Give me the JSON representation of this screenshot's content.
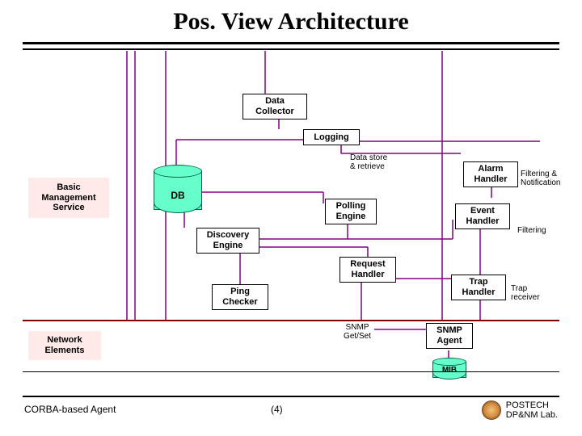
{
  "title": "Pos. View Architecture",
  "left_labels": {
    "basic_mgmt": [
      "Basic",
      "Management",
      "Service"
    ],
    "network_elements": [
      "Network",
      "Elements"
    ]
  },
  "boxes": {
    "data_collector": [
      "Data",
      "Collector"
    ],
    "logging": "Logging",
    "db": "DB",
    "discovery_engine": [
      "Discovery",
      "Engine"
    ],
    "polling_engine": [
      "Polling",
      "Engine"
    ],
    "ping_checker": [
      "Ping",
      "Checker"
    ],
    "request_handler": [
      "Request",
      "Handler"
    ],
    "alarm_handler": [
      "Alarm",
      "Handler"
    ],
    "event_handler": [
      "Event",
      "Handler"
    ],
    "trap_handler": [
      "Trap",
      "Handler"
    ],
    "snmp_agent": [
      "SNMP",
      "Agent"
    ],
    "mib": "MIB"
  },
  "annotations": {
    "data_store": [
      "Data store",
      "& retrieve"
    ],
    "filtering_notification": [
      "Filtering &",
      "Notification"
    ],
    "filtering": "Filtering",
    "trap_receiver": [
      "Trap",
      "receiver"
    ],
    "snmp_getset": [
      "SNMP",
      "Get/Set"
    ]
  },
  "footer": {
    "left": "CORBA-based Agent",
    "mid": "(4)",
    "right": [
      "POSTECH",
      "DP&NM Lab."
    ]
  }
}
